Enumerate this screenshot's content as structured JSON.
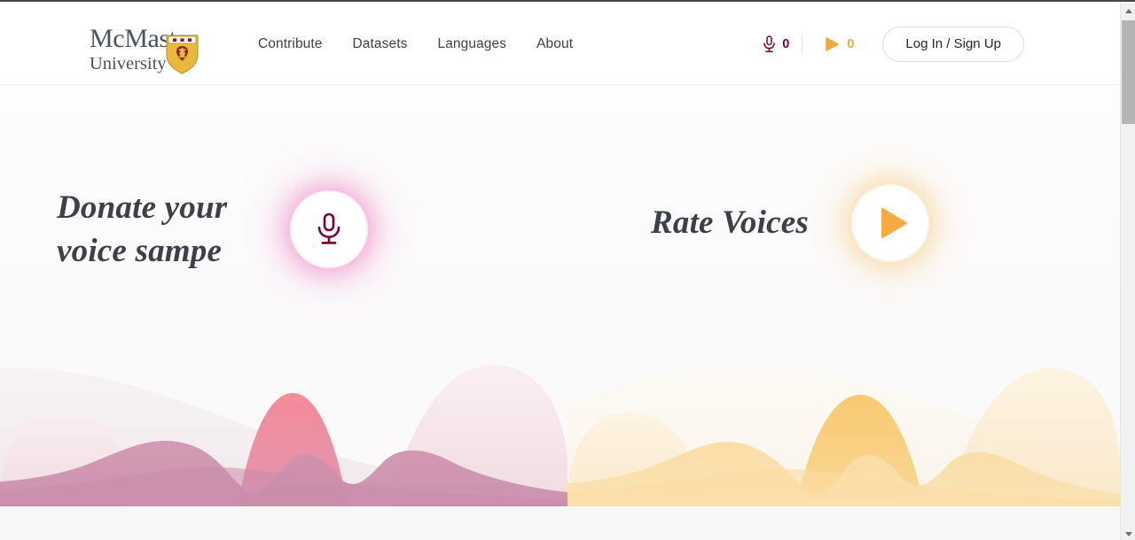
{
  "site": {
    "logo": {
      "line1": "McMaster",
      "line2": "University",
      "crest_icon": "mcmaster-crest-icon",
      "crest_gold": "#e8b93a",
      "crest_maroon": "#7a1b2b"
    },
    "nav": [
      {
        "label": "Contribute",
        "name": "nav-contribute"
      },
      {
        "label": "Datasets",
        "name": "nav-datasets"
      },
      {
        "label": "Languages",
        "name": "nav-languages"
      },
      {
        "label": "About",
        "name": "nav-about"
      }
    ],
    "counters": {
      "mic": {
        "icon": "microphone-icon",
        "value": "0",
        "color": "#7a003c"
      },
      "play": {
        "icon": "play-icon",
        "value": "0",
        "color": "#f0a93b"
      }
    },
    "auth": {
      "login_label": "Log In / Sign Up"
    }
  },
  "hero": {
    "left": {
      "title": "Donate your\nvoice sampe",
      "button_icon": "microphone-icon",
      "accent": "#7a003c",
      "glow": "#e960b4",
      "wave_colors": [
        "#f2eef0",
        "#e8c9d6",
        "#f5dfe5",
        "#f07f8f",
        "#cf8fab"
      ]
    },
    "right": {
      "title": "Rate Voices",
      "button_icon": "play-icon",
      "accent": "#f5ab42",
      "glow": "#f8be62",
      "wave_colors": [
        "#faf7f1",
        "#fae7c4",
        "#fdf3e0",
        "#f8c96f",
        "#fbdca2"
      ]
    }
  },
  "browser": {
    "scrollbar": {
      "up_icon": "scroll-up-arrow-icon",
      "down_icon": "scroll-down-arrow-icon"
    }
  }
}
